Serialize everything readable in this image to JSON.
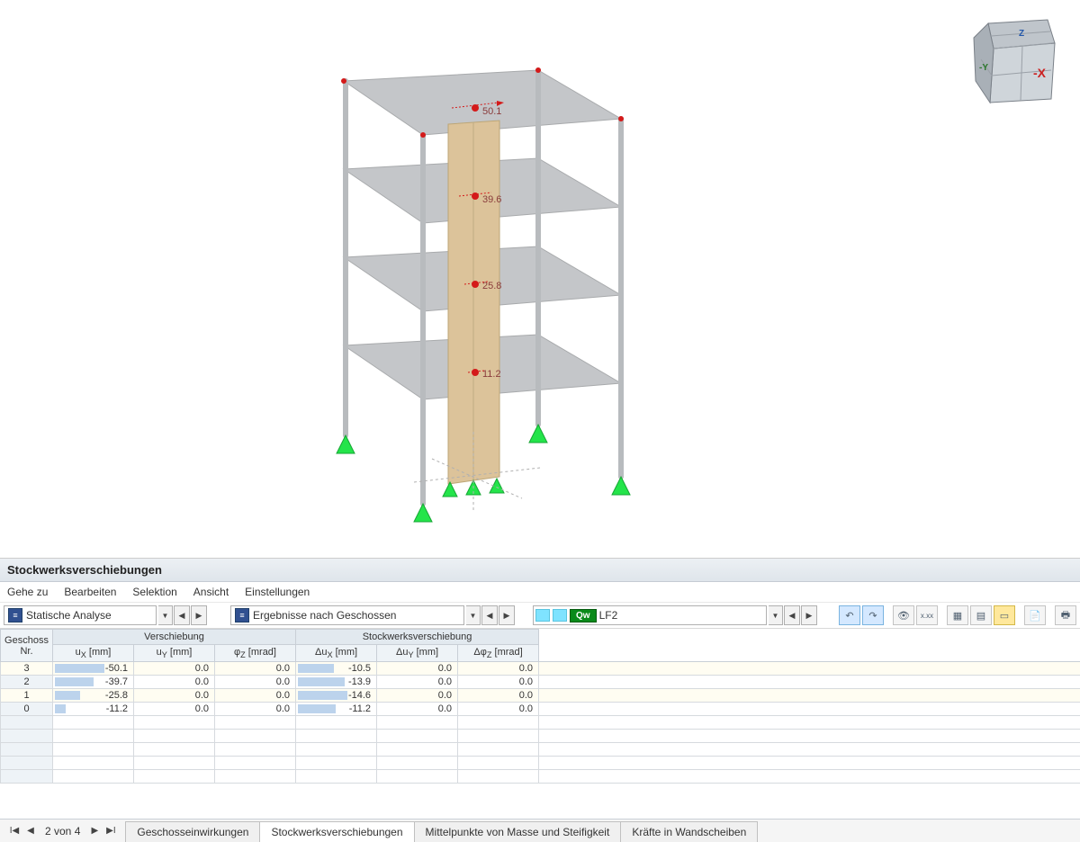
{
  "panel": {
    "title": "Stockwerksverschiebungen",
    "menu": [
      "Gehe zu",
      "Bearbeiten",
      "Selektion",
      "Ansicht",
      "Einstellungen"
    ],
    "selector_analysis": "Statische Analyse",
    "selector_results": "Ergebnisse nach Geschossen",
    "loadcase_badge": "Qw",
    "loadcase_name": "LF2"
  },
  "navcube": {
    "face_right": "-X",
    "face_left": "-Y",
    "face_top": "Z"
  },
  "table": {
    "head_geschoss_nr": "Geschoss\nNr.",
    "group_verschiebung": "Verschiebung",
    "group_stockwerks": "Stockwerksverschiebung",
    "col_ux": "u_X [mm]",
    "col_uy": "u_Y [mm]",
    "col_phiz": "φ_Z [mrad]",
    "col_dux": "Δu_X [mm]",
    "col_duy": "Δu_Y [mm]",
    "col_dphiz": "Δφ_Z [mrad]",
    "rows": [
      {
        "nr": "3",
        "ux": "-50.1",
        "uy": "0.0",
        "phiz": "0.0",
        "dux": "-10.5",
        "duy": "0.0",
        "dphiz": "0.0",
        "ux_bar": 1.0,
        "dux_bar": 0.72
      },
      {
        "nr": "2",
        "ux": "-39.7",
        "uy": "0.0",
        "phiz": "0.0",
        "dux": "-13.9",
        "duy": "0.0",
        "dphiz": "0.0",
        "ux_bar": 0.79,
        "dux_bar": 0.95
      },
      {
        "nr": "1",
        "ux": "-25.8",
        "uy": "0.0",
        "phiz": "0.0",
        "dux": "-14.6",
        "duy": "0.0",
        "dphiz": "0.0",
        "ux_bar": 0.51,
        "dux_bar": 1.0
      },
      {
        "nr": "0",
        "ux": "-11.2",
        "uy": "0.0",
        "phiz": "0.0",
        "dux": "-11.2",
        "duy": "0.0",
        "dphiz": "0.0",
        "ux_bar": 0.22,
        "dux_bar": 0.77
      }
    ]
  },
  "model_labels": {
    "l3": "50.1",
    "l2": "39.6",
    "l1": "25.8",
    "l0": "11.2"
  },
  "footer": {
    "pager_text": "2 von 4",
    "tabs": [
      "Geschosseinwirkungen",
      "Stockwerksverschiebungen",
      "Mittelpunkte von Masse und Steifigkeit",
      "Kräfte in Wandscheiben"
    ],
    "active_tab_index": 1
  }
}
